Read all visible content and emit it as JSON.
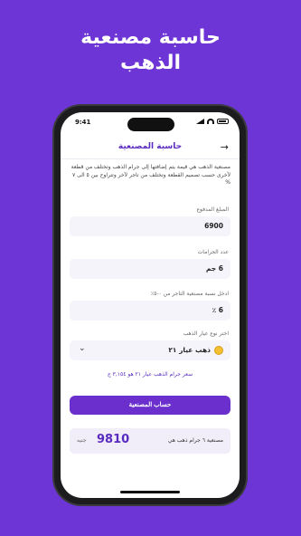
{
  "promo": {
    "headline_line1": "حاسبة مصنعية",
    "headline_line2": "الذهب"
  },
  "status_bar": {
    "time": "9:41"
  },
  "app_bar": {
    "title": "حاسبة المصنعية"
  },
  "description": "مصنعية الذهب هي قيمة يتم إضافتها إلى جرام الذهب وتختلف من قطعة لأخرى حسب تصميم القطعة وتختلف من تاجر لآخر وتتراوح بين ٥ الى ٧ %",
  "fields": {
    "amount": {
      "label": "المبلغ المدفوع",
      "value": "6900"
    },
    "grams": {
      "label": "عدد الجرامات",
      "value": "6 جم"
    },
    "margin": {
      "label": "ادخل نسبة مصنعية التاجر من ٠-٥٪",
      "value": "6 ٪"
    },
    "karat": {
      "label": "اختر نوع عيار الذهب",
      "value": "ذهب عيار ٢١"
    }
  },
  "rate_note": "سعر جرام الذهب عيار ٢١ هو ٣,١٥٤ ج",
  "calculate_button": "حساب المصنعية",
  "result": {
    "label": "مصنعية ٦ جرام ذهب هي",
    "value": "9810",
    "unit": "جنيه"
  },
  "colors": {
    "brand": "#6d35d6",
    "button": "#6a2fcc",
    "coin": "#f2c030"
  }
}
